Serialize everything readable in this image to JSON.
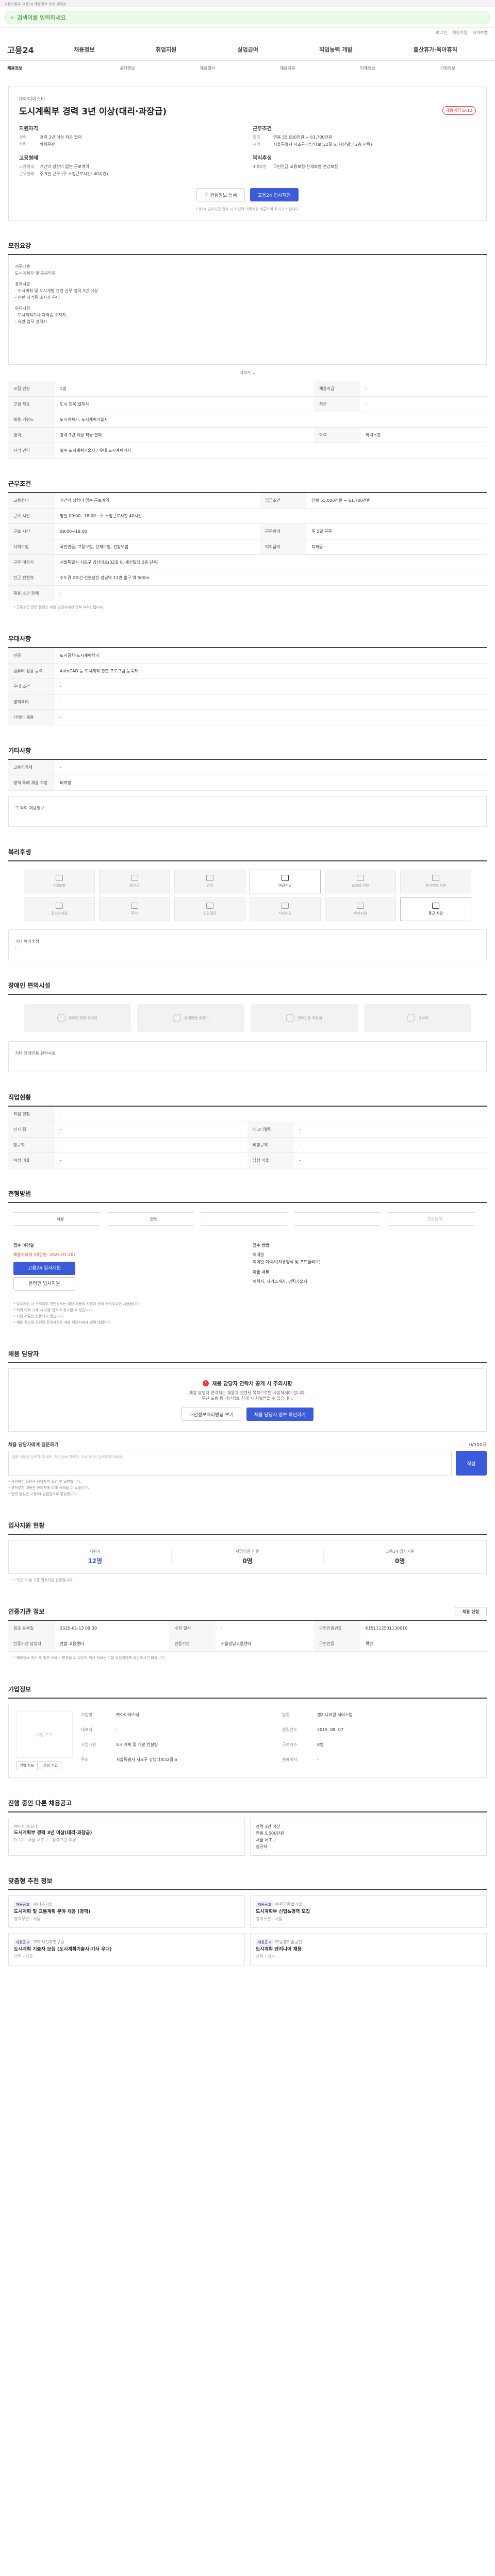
{
  "topbar": {
    "text": "고용노동부 고용24 채용정보 상세 페이지"
  },
  "search": {
    "placeholder": "검색어를 입력하세요"
  },
  "util": [
    "로그인",
    "회원가입",
    "사이트맵"
  ],
  "gnb": {
    "logo": "고용24",
    "menu": [
      "채용정보",
      "취업지원",
      "실업급여",
      "직업능력 개발",
      "출산휴가·육아휴직"
    ]
  },
  "subnav": [
    "채용정보",
    "공채정보",
    "채용행사",
    "채용지원",
    "인재정보",
    "기업정보"
  ],
  "job": {
    "company": "㈜아이에스티",
    "title": "도시계획부 경력 3년 이상(대리·과장급)",
    "badge": "채용마감 D-12",
    "left_title": "지원자격",
    "left": [
      {
        "k": "경력",
        "v": "경력 3년 이상 직급 협의"
      },
      {
        "k": "학력",
        "v": "학력무관"
      }
    ],
    "left2_title": "고용형태",
    "left2": [
      {
        "k": "고용형태",
        "v": "기간의 정함이 없는 근로계약"
      },
      {
        "k": "근무형태",
        "v": "주 5일 근무 (주 소정근로시간: 40시간)"
      }
    ],
    "right_title": "근무조건",
    "right": [
      {
        "k": "임금",
        "v": "연봉 55,000천원 ~ 61,700천원"
      },
      {
        "k": "지역",
        "v": "서울특별시 서초구 강남대로(32길 6, 세진빌딩 2층 단독)"
      }
    ],
    "right2_title": "복리후생",
    "right2": [
      {
        "k": "4대보험",
        "v": "국민연금·고용보험·산재보험·건강보험"
      }
    ],
    "btn_scrap": "관심정보 등록",
    "btn_apply": "고용24 입사지원",
    "note": "고용24 입사지원 접수 시 최신의 이력서를 제출하여 주시기 바랍니다."
  },
  "recruit": {
    "title": "모집요강",
    "lines": [
      "직무내용",
      "도시계획부 및 공공부문",
      "",
      "경력사항",
      "- 도시계획 및 도시개발 관련 실무 경력 3년 이상",
      "- 관련 자격증 소지자 우대",
      "",
      "우대사항",
      "- 도시계획기사 자격증 소지자",
      "- 유관 업무 경력자"
    ],
    "more": "더보기",
    "rows": [
      {
        "k": "모집 인원",
        "v": "1명",
        "k2": "채용직급",
        "v2": "-"
      },
      {
        "k": "모집 직종",
        "v": "도시·토목·설계사",
        "k2": "직무",
        "v2": "-"
      },
      {
        "k": "채용 키워드",
        "v": "도시계획기, 도시계획기술자",
        "k2": "",
        "v2": ""
      },
      {
        "k": "경력",
        "v": "경력 3년 이상 직급 협의",
        "k2": "학력",
        "v2": "학력무관"
      },
      {
        "k": "자격 면허",
        "v": "필수 도시계획기술사 / 우대 도시계획기사",
        "k2": "",
        "v2": ""
      }
    ]
  },
  "conditions": {
    "title": "근무조건",
    "rows": [
      {
        "k": "고용형태",
        "v": "기간의 정함이 없는 근로계약",
        "k2": "임금조건",
        "v2": "연봉 55,000천원 ~ 61,700천원"
      },
      {
        "k": "근무 시간",
        "v": "평일 09:00~18:00 · 주 소정근로시간 40시간",
        "k2": "",
        "v2": ""
      },
      {
        "k": "근로 시간",
        "v": "09:00~18:00",
        "k2": "근무형태",
        "v2": "주 5일 근무"
      },
      {
        "k": "사회보험",
        "v": "국민연금, 고용보험, 산재보험, 건강보험",
        "k2": "퇴직급여",
        "v2": "퇴직금"
      },
      {
        "k": "근무 예정지",
        "v": "서울특별시 서초구 강남대로(32길 6, 세진빌딩 2층 단독)",
        "k2": "",
        "v2": ""
      },
      {
        "k": "인근 전철역",
        "v": "수도권 2호선·신분당선 강남역 11번 출구 약 500m",
        "k2": "",
        "v2": ""
      },
      {
        "k": "채용 소관 장애",
        "v": "-",
        "k2": "",
        "v2": ""
      }
    ],
    "note": "* 근로조건 관련 문의는 채용 담당자에게 연락 부탁드립니다."
  },
  "preference": {
    "title": "우대사항",
    "rows": [
      {
        "k": "전공",
        "v": "도시공학·도시계획학과"
      },
      {
        "k": "컴퓨터 활용 능력",
        "v": "AutoCAD 등 도시계획 관련 프로그램 능숙자"
      },
      {
        "k": "우대 조건",
        "v": "-"
      },
      {
        "k": "병역특례",
        "v": "-"
      },
      {
        "k": "장애인 채용",
        "v": "-"
      }
    ]
  },
  "etc": {
    "title": "기타사항",
    "rows": [
      {
        "k": "고용허가제",
        "v": "-"
      },
      {
        "k": "병역 특례 채용 희망",
        "v": "비희망"
      }
    ],
    "extra": "그 외의 채용정보"
  },
  "welfare": {
    "title": "복리후생",
    "items": [
      "4대보험",
      "퇴직금",
      "연차",
      "야근수당",
      "교육비 지원",
      "자기계발 지원",
      "경조사지원",
      "주차",
      "건강검진",
      "식대지원",
      "휴가지원",
      "통근 차량"
    ],
    "on": [
      3,
      11
    ],
    "extra_title": "기타 복리후생",
    "extra": "-"
  },
  "disability": {
    "title": "장애인 편의시설",
    "items": [
      "장애인 전용 주차장",
      "장애인용 승강기",
      "장애인용 화장실",
      "경사로"
    ],
    "extra_title": "기타 장애인용 편의시설",
    "extra": "-"
  },
  "career": {
    "title": "직업현황",
    "rows": [
      {
        "k": "직업 현황",
        "v": "-",
        "k2": "",
        "v2": ""
      },
      {
        "k": "인사 팀",
        "v": "-",
        "k2": "테크니컬팀",
        "v2": "-"
      },
      {
        "k": "정규직",
        "v": "-",
        "k2": "비정규직",
        "v2": "-"
      },
      {
        "k": "여성 비율",
        "v": "-",
        "k2": "남성 비율",
        "v2": "-"
      }
    ]
  },
  "process": {
    "title": "전형방법",
    "steps": [
      "서류",
      "면접",
      "",
      "",
      "최종합격"
    ],
    "active": 2,
    "apply_title": "접수 마감일",
    "deadline": "채용시까지 (마감일: 2025-01-20)",
    "apply_btn": "고용24 입사지원",
    "apply_btn2": "온라인 입사지원",
    "method_title": "접수 방법",
    "methods": [
      "이메일",
      "이메일 이력서(자유양식 및 포트폴리오)",
      "",
      "제출 서류",
      "이력서, 자기소개서, 경력기술서"
    ],
    "notes": [
      "* 입사지원 시 구직자의 개인정보는 해당 채용의 지원자 관리 목적으로만 사용됩니다.",
      "* 허위 이력 기재 시 채용 합격이 취소될 수 있습니다.",
      "* 지원 서류는 반환되지 않습니다.",
      "* 채용 정보와 관련된 문의사항은 채용 담당자에게 연락 바랍니다."
    ]
  },
  "manager": {
    "title": "채용 담당자",
    "alert": "채용 담당자 연락처 공개 시 주의사항",
    "desc": "채용 담당자 연락처는 채용과 관련된 목적으로만 사용하셔야 합니다.",
    "desc2": "무단 도용 등 개인정보 침해 시 처벌받을 수 있습니다.",
    "btn1": "개인정보처리방침 보기",
    "btn2": "채용 담당자 정보 확인하기"
  },
  "inquiry": {
    "title": "채용 담당자에게 질문하기",
    "count": "0/500자",
    "placeholder": "질문 내용을 입력해 주세요. 개인정보(연락처, 주소 등)는 입력하지 마세요.",
    "btn": "작성",
    "notes": [
      "* 작성하신 질문은 담당자가 확인 후 답변합니다.",
      "* 부적절한 내용은 관리자에 의해 삭제될 수 있습니다.",
      "* 답변 알림은 고용24 알림함으로 발송됩니다."
    ]
  },
  "stats": {
    "title": "입사지원 현황",
    "items": [
      {
        "k": "지원자",
        "v": "12명"
      },
      {
        "k": "취업성공 인원",
        "v": "0명"
      },
      {
        "k": "고용24 입사지원",
        "v": "0명"
      }
    ],
    "note": "* 최근 30일 기준 입사지원 현황입니다."
  },
  "info": {
    "title": "인증기관 정보",
    "btn": "채용 신청",
    "rows": [
      {
        "k": "최초 등록일",
        "v": "2025-01-13 09:30",
        "k2": "수정 일시",
        "v2": "-",
        "k3": "구인인증번호",
        "v3": "K151112501130010"
      },
      {
        "k": "인증기관 담당자",
        "v": "관할 고용센터",
        "k2": "인증기관",
        "v2": "서울강남고용센터",
        "k3": "구인인증",
        "v3": "확인"
      }
    ],
    "note": "* 채용정보 게시 후 일부 내용이 변경될 수 있으며 최신 정보는 기업 담당자에게 확인하시기 바랍니다."
  },
  "companyinfo": {
    "title": "기업정보",
    "logo": "기업 로고",
    "btn1": "기업 정보",
    "btn2": "관심 기업",
    "fields": [
      {
        "k": "기업명",
        "v": "㈜아이에스티"
      },
      {
        "k": "업종",
        "v": "엔지니어링 서비스업"
      },
      {
        "k": "대표자",
        "v": "-"
      },
      {
        "k": "설립년도",
        "v": "2015. 08. 07"
      },
      {
        "k": "사업내용",
        "v": "도시계획 및 개발 컨설팅"
      },
      {
        "k": "근로자수",
        "v": "8명"
      },
      {
        "k": "주소",
        "v": "서울특별시 서초구 강남대로32길 6"
      },
      {
        "k": "홈페이지",
        "v": "-"
      }
    ]
  },
  "similar": {
    "title": "진행 중인 다른 채용공고",
    "company": "㈜아이에스티",
    "job": "도시계획부 경력 3년 이상(대리·과장급)",
    "meta": "D-12 · 서울 서초구 · 경력 3년 이상",
    "right": [
      "경력 3년 이상",
      "연봉 5,500만원",
      "서울 서초구",
      "정규직"
    ]
  },
  "recommend": {
    "title": "맞춤형 추천 정보",
    "items": [
      {
        "chip": "채용공고",
        "company": "㈜다우기술",
        "title": "도시계획 및 교통계획 분야 채용 (경력)",
        "meta": "경력무관 · 서울"
      },
      {
        "chip": "채용공고",
        "company": "㈜한국종합기술",
        "title": "도시계획부 신입&경력 모집",
        "meta": "경력무관 · 서울"
      },
      {
        "chip": "채용공고",
        "company": "㈜도시건축연구원",
        "title": "도시계획 기술자 모집 (도시계획기술사·기사 우대)",
        "meta": "경력 · 서울"
      },
      {
        "chip": "채용공고",
        "company": "㈜동명기술공단",
        "title": "도시계획 엔지니어 채용",
        "meta": "경력 · 경기"
      }
    ]
  }
}
